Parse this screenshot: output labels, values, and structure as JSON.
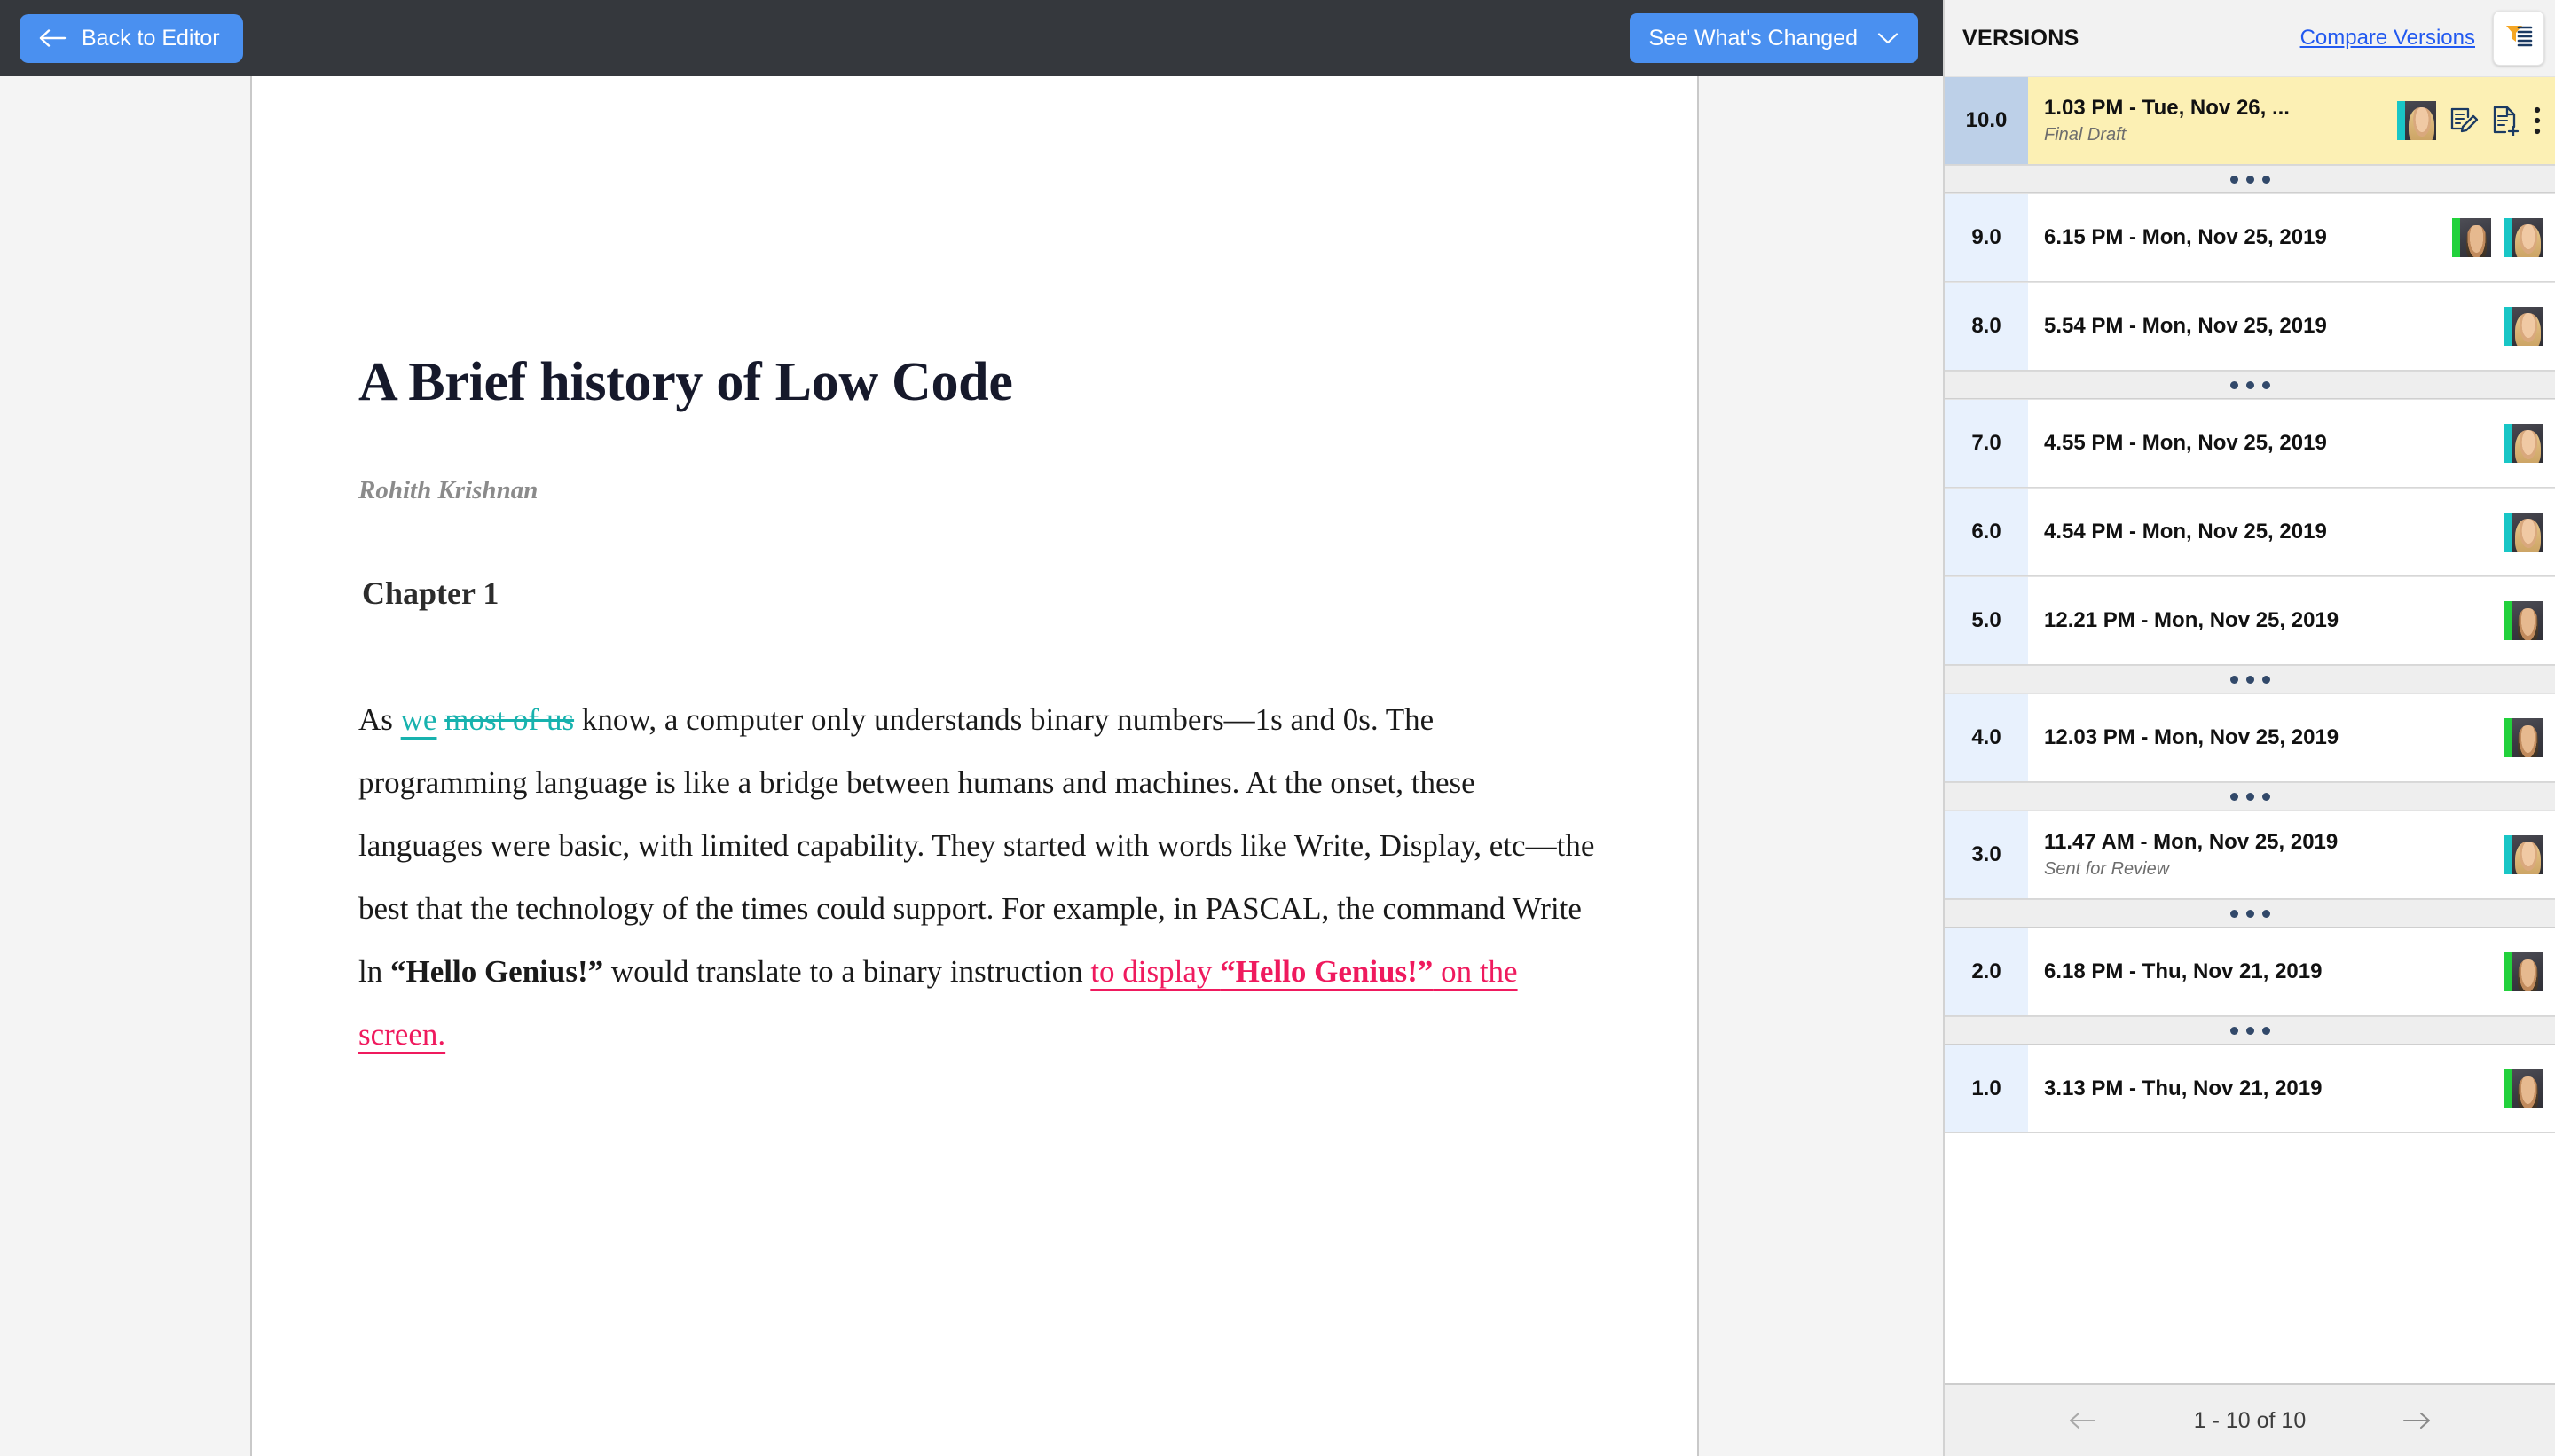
{
  "toolbar": {
    "back_label": "Back to Editor",
    "back_icon": "arrow-left-icon",
    "changes_label": "See What's Changed",
    "changes_icon": "chevron-down-icon"
  },
  "document": {
    "title": "A Brief history of Low Code",
    "author": "Rohith Krishnan",
    "chapter": "Chapter 1",
    "paragraph": {
      "seg_1": "As ",
      "insert_teal": "we",
      "delete_teal": "most of us",
      "seg_2": " know, a computer only understands binary numbers—1s and 0s. The programming language is like a bridge between humans and machines. At the onset, these languages were basic, with limited capability. They started with words like  Write,  Display, etc—the best that the technology of the times could support. For example, in  PASCAL, the command Write ln  ",
      "bold_quote_1": "“Hello Genius!”",
      "seg_3": " would translate to a binary instruction ",
      "insert_pink_1": "to display  ",
      "insert_pink_bold": "“Hello Genius!”",
      "insert_pink_2": " on the screen."
    }
  },
  "versions_panel": {
    "title": "VERSIONS",
    "compare_label": "Compare Versions",
    "filter_icon": "filter-funnel-icon",
    "row_icons": {
      "edit": "edit-document-icon",
      "add": "add-document-icon",
      "more": "more-vertical-icon",
      "avatar": "avatar"
    },
    "separator_icon": "three-dots-icon",
    "rows": [
      {
        "version": "10.0",
        "timestamp": "1.03 PM - Tue, Nov 26, ...",
        "tag": "Final Draft",
        "active": true,
        "avatars": [
          "female-teal"
        ],
        "has_actions": true
      },
      {
        "version": "9.0",
        "timestamp": "6.15 PM - Mon, Nov 25, 2019",
        "tag": "",
        "active": false,
        "avatars": [
          "male-green",
          "female-teal"
        ],
        "has_actions": false
      },
      {
        "version": "8.0",
        "timestamp": "5.54 PM - Mon, Nov 25, 2019",
        "tag": "",
        "active": false,
        "avatars": [
          "female-teal"
        ],
        "has_actions": false
      },
      {
        "version": "7.0",
        "timestamp": "4.55 PM - Mon, Nov 25, 2019",
        "tag": "",
        "active": false,
        "avatars": [
          "female-teal"
        ],
        "has_actions": false
      },
      {
        "version": "6.0",
        "timestamp": "4.54 PM - Mon, Nov 25, 2019",
        "tag": "",
        "active": false,
        "avatars": [
          "female-teal"
        ],
        "has_actions": false
      },
      {
        "version": "5.0",
        "timestamp": "12.21 PM - Mon, Nov 25, 2019",
        "tag": "",
        "active": false,
        "avatars": [
          "male-green"
        ],
        "has_actions": false
      },
      {
        "version": "4.0",
        "timestamp": "12.03 PM - Mon, Nov 25, 2019",
        "tag": "",
        "active": false,
        "avatars": [
          "male-green"
        ],
        "has_actions": false
      },
      {
        "version": "3.0",
        "timestamp": "11.47 AM - Mon, Nov 25, 2019",
        "tag": "Sent for Review",
        "active": false,
        "avatars": [
          "female-teal"
        ],
        "has_actions": false
      },
      {
        "version": "2.0",
        "timestamp": "6.18 PM - Thu, Nov 21, 2019",
        "tag": "",
        "active": false,
        "avatars": [
          "male-green"
        ],
        "has_actions": false
      },
      {
        "version": "1.0",
        "timestamp": "3.13 PM - Thu, Nov 21, 2019",
        "tag": "",
        "active": false,
        "avatars": [
          "male-green"
        ],
        "has_actions": false
      }
    ],
    "separators_after": [
      0,
      2,
      5,
      6,
      7,
      8
    ],
    "pagination": {
      "label": "1 - 10 of 10",
      "prev_icon": "arrow-left-icon",
      "next_icon": "arrow-right-icon"
    }
  },
  "colors": {
    "accent_blue": "#4a90f0",
    "topbar": "#35383d",
    "active_row": "#fcf0b4",
    "insert_teal": "#17b2ae",
    "insert_pink": "#ef1a5e",
    "link_blue": "#2159f0",
    "filter_orange": "#f5a623",
    "avatar_green": "#22d13c",
    "avatar_teal": "#19c6c6"
  }
}
